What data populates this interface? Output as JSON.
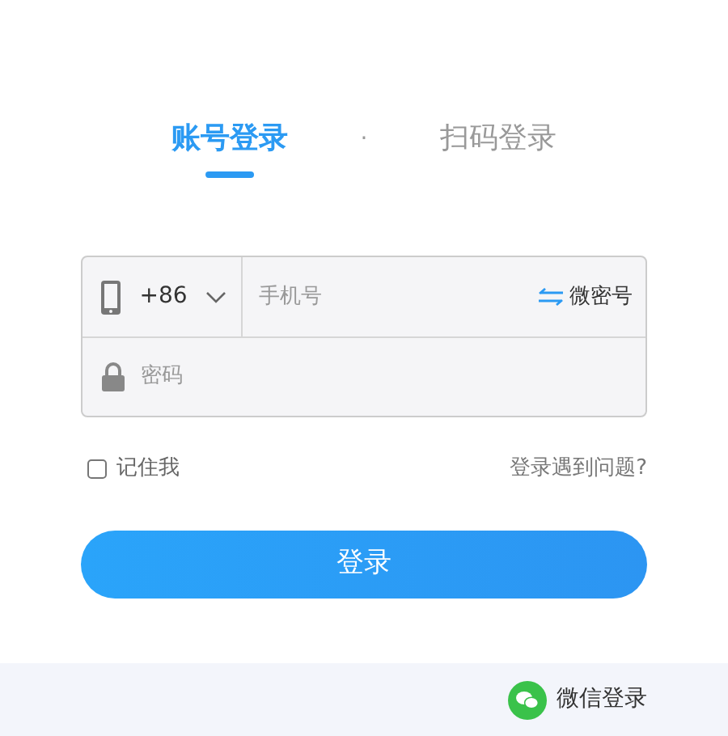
{
  "tabs": [
    {
      "label": "账号登录",
      "selected": true
    },
    {
      "label": "扫码登录",
      "selected": false
    }
  ],
  "tab_separator": "·",
  "phone": {
    "country_code": "+86",
    "placeholder": "手机号",
    "switch_link": "微密号"
  },
  "password": {
    "placeholder": "密码"
  },
  "remember": {
    "label": "记住我",
    "checked": false
  },
  "help_link": "登录遇到问题?",
  "login_button": "登录",
  "footer": {
    "wechat_login": "微信登录"
  }
}
